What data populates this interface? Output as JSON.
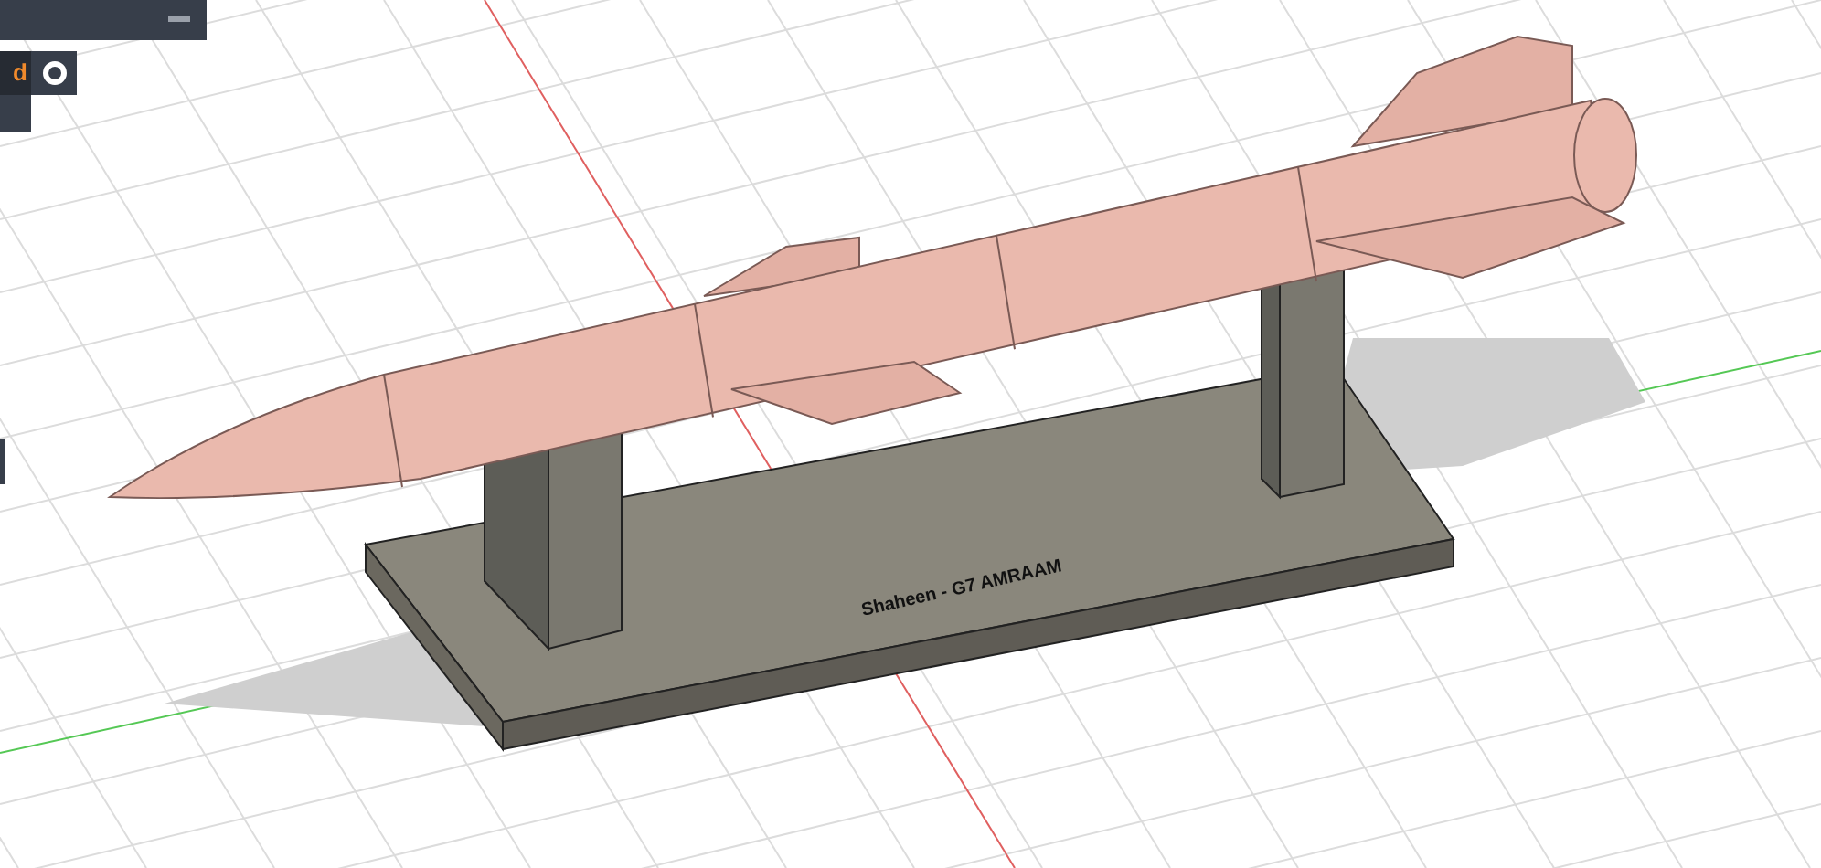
{
  "side_panel": {
    "item_label": "d"
  },
  "viewport": {
    "engraved_label": "Shaheen - G7 AMRAAM"
  }
}
